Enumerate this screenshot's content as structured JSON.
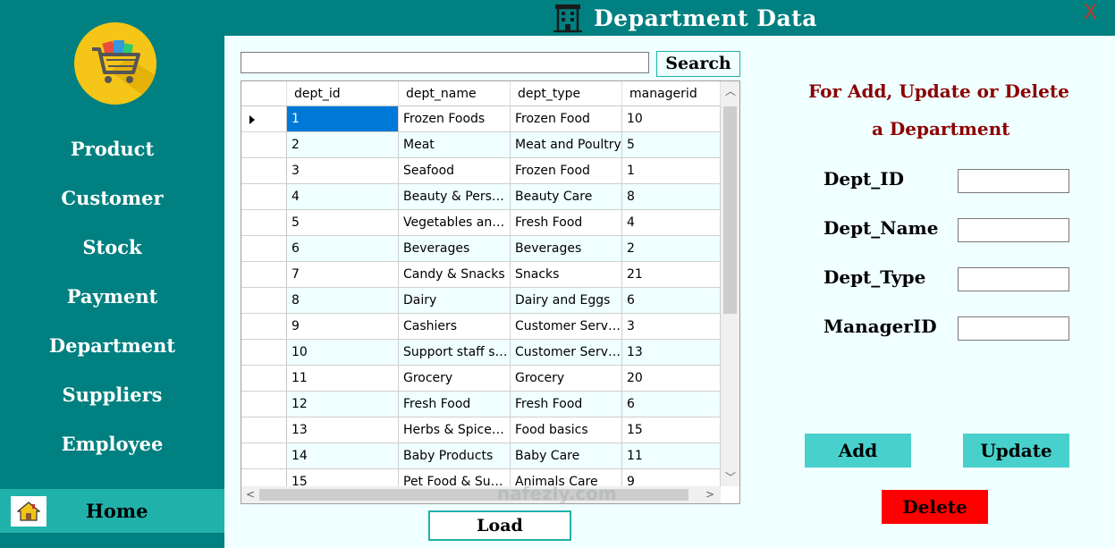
{
  "window": {
    "title": "Department Data",
    "close_label": "X"
  },
  "colors": {
    "sidebar_bg": "#008080",
    "content_bg": "#f0ffff",
    "home_highlight": "#20b2aa",
    "heading_color": "#8b0000",
    "add_update_bg": "#48d1cc",
    "delete_bg": "#ff0000",
    "selection_bg": "#0078d7"
  },
  "sidebar": {
    "logo_icon": "shopping-cart-icon",
    "items": [
      {
        "label": "Product"
      },
      {
        "label": "Customer"
      },
      {
        "label": "Stock"
      },
      {
        "label": "Payment"
      },
      {
        "label": "Department"
      },
      {
        "label": "Suppliers"
      },
      {
        "label": "Employee"
      }
    ],
    "home": {
      "label": "Home",
      "icon": "home-icon"
    }
  },
  "search": {
    "value": "",
    "button_label": "Search"
  },
  "table": {
    "columns": [
      "dept_id",
      "dept_name",
      "dept_type",
      "managerid"
    ],
    "selected_row": 0,
    "rows": [
      [
        "1",
        "Frozen Foods",
        "Frozen Food",
        "10"
      ],
      [
        "2",
        "Meat",
        "Meat and Poultry",
        "5"
      ],
      [
        "3",
        "Seafood",
        "Frozen Food",
        "1"
      ],
      [
        "4",
        "Beauty & Perso...",
        "Beauty Care",
        "8"
      ],
      [
        "5",
        "Vegetables and ...",
        "Fresh Food",
        "4"
      ],
      [
        "6",
        "Beverages",
        "Beverages",
        "2"
      ],
      [
        "7",
        "Candy & Snacks",
        "Snacks",
        "21"
      ],
      [
        "8",
        "Dairy",
        "Dairy and Eggs",
        "6"
      ],
      [
        "9",
        "Cashiers",
        "Customer Service",
        "3"
      ],
      [
        "10",
        "Support staff su...",
        "Customer Service",
        "13"
      ],
      [
        "11",
        "Grocery",
        "Grocery",
        "20"
      ],
      [
        "12",
        "Fresh Food",
        "Fresh Food",
        "6"
      ],
      [
        "13",
        "Herbs & Spices ...",
        "Food basics",
        "15"
      ],
      [
        "14",
        "Baby Products",
        "Baby Care",
        "11"
      ],
      [
        "15",
        "Pet Food & Sup...",
        "Animals Care",
        "9"
      ]
    ]
  },
  "load_button": "Load",
  "form": {
    "heading_line1": "For Add, Update or Delete",
    "heading_line2": "a Department",
    "fields": [
      {
        "label": "Dept_ID",
        "value": ""
      },
      {
        "label": "Dept_Name",
        "value": ""
      },
      {
        "label": "Dept_Type",
        "value": ""
      },
      {
        "label": "ManagerID",
        "value": ""
      }
    ],
    "add_label": "Add",
    "update_label": "Update",
    "delete_label": "Delete"
  },
  "watermark": "nafezly.com"
}
